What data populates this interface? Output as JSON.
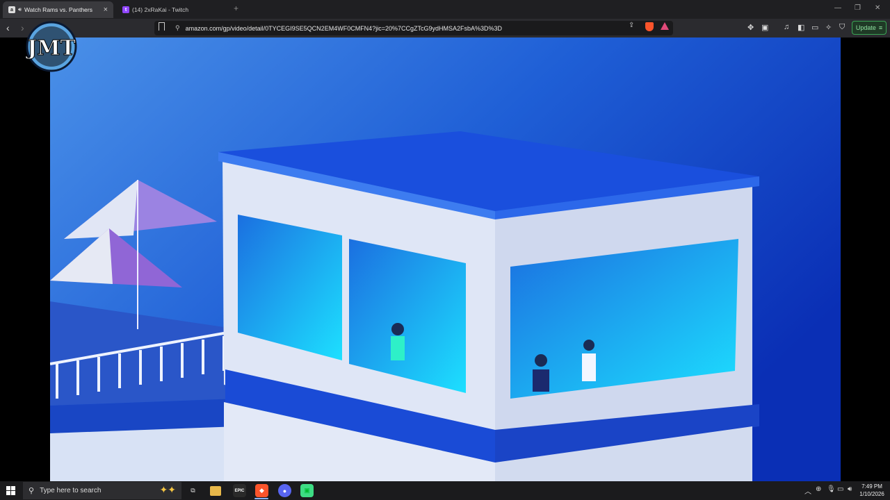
{
  "tabs": [
    {
      "title": "Watch Rams vs. Panthers",
      "active": true,
      "favicon": "amazon-icon",
      "audio": "speaker-icon"
    },
    {
      "title": "(14) 2xRaKai - Twitch",
      "active": false,
      "favicon": "twitch-icon"
    }
  ],
  "address_bar": {
    "url": "amazon.com/gp/video/detail/0TYCEGI9SE5QCN2EM4WF0CMFN4?jic=20%7CCgZTcG9ydHMSA2FsbA%3D%3D"
  },
  "toolbar": {
    "update_label": "Update"
  },
  "logo": {
    "text": "JMT"
  },
  "taskbar": {
    "search_placeholder": "Type here to search",
    "pinned_apps": [
      "task-view-icon",
      "file-explorer-icon",
      "epic-games-icon",
      "brave-icon",
      "discord-icon",
      "android-app-icon"
    ],
    "epic_label": "EPIC",
    "time": "7:49 PM",
    "date": "1/10/2026"
  },
  "colors": {
    "update_border": "#3aa655",
    "brave": "#fb542b",
    "twitch": "#9146ff",
    "discord": "#5865f2"
  }
}
